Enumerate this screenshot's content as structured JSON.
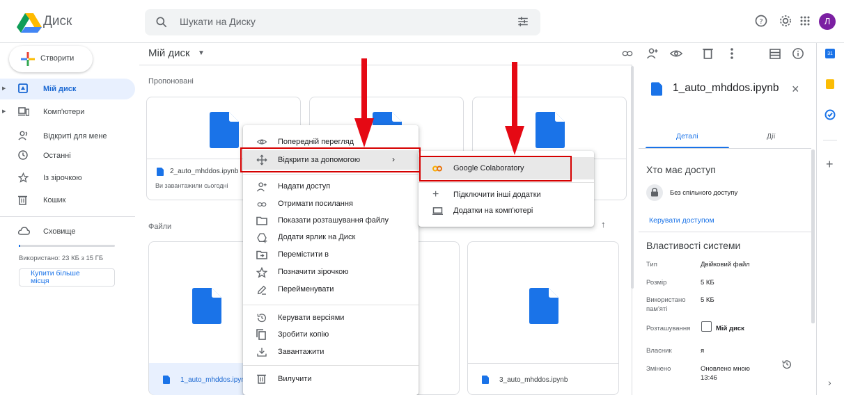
{
  "header": {
    "app_title": "Диск",
    "search_placeholder": "Шукати на Диску",
    "avatar_letter": "Л",
    "icons": [
      "help-icon",
      "settings-icon",
      "apps-grid-icon"
    ]
  },
  "sidebar": {
    "create_label": "Створити",
    "items": [
      {
        "label": "Мій диск",
        "icon": "drive-icon",
        "active": true
      },
      {
        "label": "Комп'ютери",
        "icon": "computer-icon"
      },
      {
        "label": "Відкриті для мене",
        "icon": "shared-people-icon"
      },
      {
        "label": "Останні",
        "icon": "clock-icon"
      },
      {
        "label": "Із зірочкою",
        "icon": "star-icon"
      },
      {
        "label": "Кошик",
        "icon": "trash-icon"
      },
      {
        "label": "Сховище",
        "icon": "cloud-icon"
      }
    ],
    "storage_text": "Використано: 23 КБ з 15 ГБ",
    "storage_fraction": 1.5e-06,
    "buy_label": "Купити більше місця"
  },
  "main": {
    "breadcrumb": "Мій диск",
    "suggested_title": "Пропоновані",
    "files_title": "Файли",
    "suggested_cards": [
      {
        "name": "2_auto_mhddos.ipynb",
        "sub": "Ви завантажили сьогодні"
      },
      {
        "name": "",
        "sub": ""
      },
      {
        "name": "",
        "sub": ""
      }
    ],
    "file_cards": [
      {
        "name": "1_auto_mhddos.ipyn"
      },
      {
        "name": ""
      },
      {
        "name": "3_auto_mhddos.ipynb"
      }
    ]
  },
  "context_menu": {
    "items": [
      {
        "label": "Попередній перегляд",
        "icon": "eye-icon"
      },
      {
        "label": "Відкрити за допомогою",
        "icon": "move-arrows-icon",
        "has_submenu": true
      },
      {
        "label": "Надати доступ",
        "icon": "person-add-icon"
      },
      {
        "label": "Отримати посилання",
        "icon": "link-icon"
      },
      {
        "label": "Показати розташування файлу",
        "icon": "folder-icon"
      },
      {
        "label": "Додати ярлик на Диск",
        "icon": "add-shortcut-icon"
      },
      {
        "label": "Перемістити в",
        "icon": "move-folder-icon"
      },
      {
        "label": "Позначити зірочкою",
        "icon": "star-icon"
      },
      {
        "label": "Перейменувати",
        "icon": "pencil-icon"
      },
      {
        "label": "Керувати версіями",
        "icon": "history-icon"
      },
      {
        "label": "Зробити копію",
        "icon": "copy-icon"
      },
      {
        "label": "Завантажити",
        "icon": "download-icon"
      },
      {
        "label": "Вилучити",
        "icon": "trash-icon"
      }
    ]
  },
  "submenu": {
    "items": [
      {
        "label": "Google Colaboratory",
        "icon": "colab-icon"
      },
      {
        "label": "Підключити інші додатки",
        "icon": "plus-icon"
      },
      {
        "label": "Додатки на комп'ютері",
        "icon": "laptop-icon"
      }
    ]
  },
  "details": {
    "file_title": "1_auto_mhddos.ipynb",
    "tabs": [
      "Деталі",
      "Дії"
    ],
    "access_heading": "Хто має доступ",
    "access_status": "Без спільного доступу",
    "manage_access": "Керувати доступом",
    "props_heading": "Властивості системи",
    "props": [
      {
        "key": "Тип",
        "value": "Двійковий файл"
      },
      {
        "key": "Розмір",
        "value": "5 КБ"
      },
      {
        "key": "Використано пам'яті",
        "value": "5 КБ"
      },
      {
        "key": "Розташування",
        "value": "Мій диск"
      },
      {
        "key": "Власник",
        "value": "я"
      },
      {
        "key": "Змінено",
        "value": "Оновлено мною 13:46"
      }
    ]
  },
  "colors": {
    "accent": "#1a73e8",
    "annotation_red": "#d50000",
    "file_blue": "#1a73e8",
    "avatar": "#7b1fa2"
  }
}
